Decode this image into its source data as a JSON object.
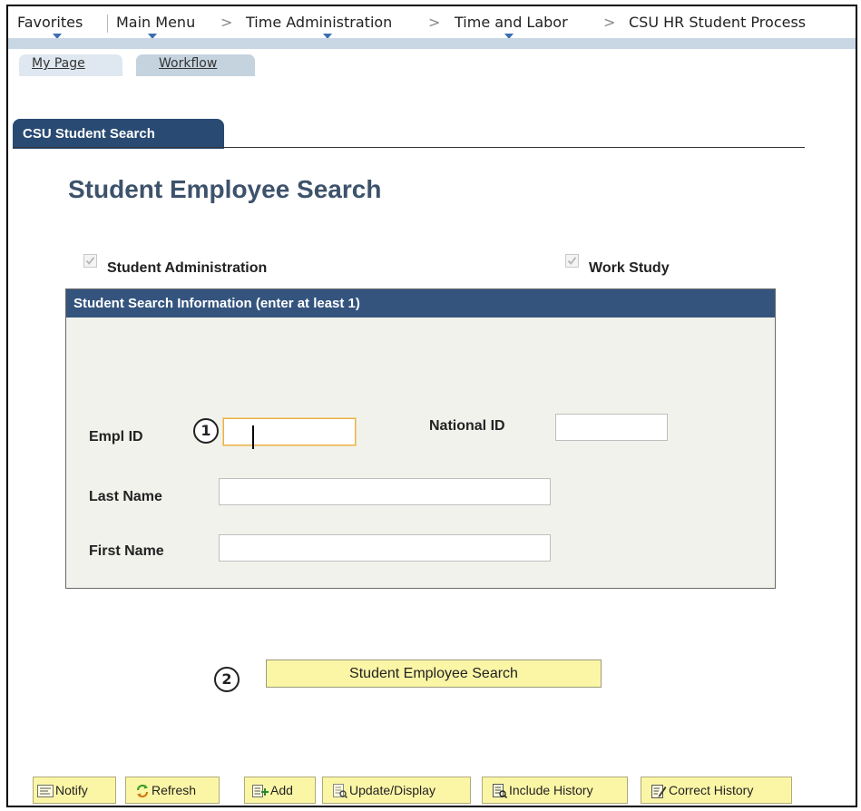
{
  "breadcrumbs": {
    "items": [
      "Favorites",
      "Main Menu",
      "Time Administration",
      "Time and Labor",
      "CSU HR Student Process"
    ],
    "separator": ">"
  },
  "page_tabs": [
    {
      "label": "My Page",
      "active": true
    },
    {
      "label": "Workflow",
      "active": false
    }
  ],
  "component_tab": {
    "label": "CSU Student Search"
  },
  "page_title": "Student Employee Search",
  "checkboxes": [
    {
      "label": "Student Administration",
      "checked": true,
      "disabled": true
    },
    {
      "label": "Work Study",
      "checked": true,
      "disabled": true
    }
  ],
  "search_group": {
    "header": "Student Search Information (enter at least 1)",
    "fields": {
      "empl_id": {
        "label": "Empl ID",
        "value": ""
      },
      "national_id": {
        "label": "National ID",
        "value": ""
      },
      "last_name": {
        "label": "Last Name",
        "value": ""
      },
      "first_name": {
        "label": "First Name",
        "value": ""
      }
    }
  },
  "callouts": [
    "1",
    "2"
  ],
  "search_button": {
    "label": "Student Employee Search"
  },
  "toolbar": [
    {
      "label": "Notify",
      "icon": "notify-icon"
    },
    {
      "label": "Refresh",
      "icon": "refresh-icon"
    },
    {
      "label": "Add",
      "icon": "add-icon"
    },
    {
      "label": "Update/Display",
      "icon": "update-display-icon"
    },
    {
      "label": "Include History",
      "icon": "include-history-icon"
    },
    {
      "label": "Correct History",
      "icon": "correct-history-icon"
    }
  ],
  "colors": {
    "component_tab_bg": "#294a72",
    "group_header_bg": "#34547e",
    "title_color": "#3d526b",
    "button_bg": "#fbf6a6",
    "focus_border": "#e7b24c",
    "nav_arrow": "#3a6fb0"
  }
}
